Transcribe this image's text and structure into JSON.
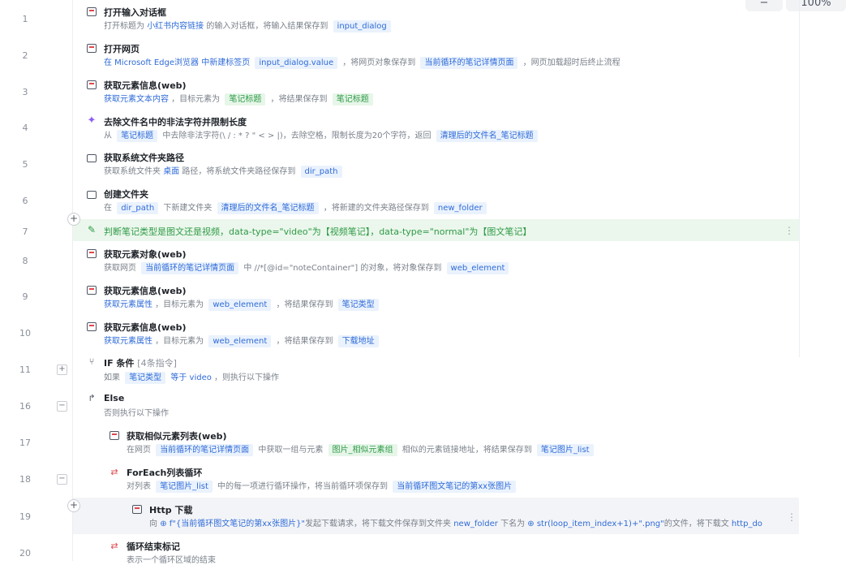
{
  "toolbar": {
    "zoom_out": "−",
    "zoom_level": "100%"
  },
  "steps": [
    {
      "line": "1",
      "title": "打开输入对话框",
      "desc": "打开标题为 {小红书内容链接} 的输入对话框，将输入结果保存到 [input_dialog]"
    },
    {
      "line": "2",
      "title": "打开网页",
      "desc": "在 Microsoft Edge浏览器 中新建标签页 [input_dialog.value] ，将网页对象保存到 [当前循环的笔记详情页面] ，网页加载超时后终止流程"
    },
    {
      "line": "3",
      "title": "获取元素信息(web)",
      "desc": "获取元素文本内容 ，目标元素为 [笔记标题] ，将结果保存到 [笔记标题]"
    },
    {
      "line": "4",
      "title": "去除文件名中的非法字符并限制长度",
      "desc": "从 [笔记标题] 中去除非法字符(\\ / : * ? \" < > |)，去除空格，限制长度为20个字符，返回 [清理后的文件名_笔记标题]"
    },
    {
      "line": "5",
      "title": "获取系统文件夹路径",
      "desc": "获取系统文件夹 桌面 路径，将系统文件夹路径保存到 [dir_path]"
    },
    {
      "line": "6",
      "title": "创建文件夹",
      "desc": "在 [dir_path] 下新建文件夹 [清理后的文件名_笔记标题] ，将新建的文件夹路径保存到 [new_folder]"
    },
    {
      "line": "7",
      "title": "判断笔记类型是图文还是视频，data-type=\"video\"为【视频笔记】，data-type=\"normal\"为【图文笔记】"
    },
    {
      "line": "8",
      "title": "获取元素对象(web)",
      "desc": "获取网页 [当前循环的笔记详情页面] 中 //*[@id=\"noteContainer\"] 的对象，将对象保存到 [web_element]"
    },
    {
      "line": "9",
      "title": "获取元素信息(web)",
      "desc": "获取元素属性 ，目标元素为 [web_element] ，将结果保存到 [笔记类型]"
    },
    {
      "line": "10",
      "title": "获取元素信息(web)",
      "desc": "获取元素属性 ，目标元素为 [web_element] ，将结果保存到 [下载地址]"
    },
    {
      "line": "11",
      "title": "IF 条件",
      "count": "[4条指令]",
      "desc": "如果 [笔记类型] 等于 video ，则执行以下操作"
    },
    {
      "line": "16",
      "title": "Else",
      "desc": "否则执行以下操作"
    },
    {
      "line": "17",
      "title": "获取相似元素列表(web)",
      "desc": "在网页 [当前循环的笔记详情页面] 中获取一组与元素 [图片_相似元素组] 相似的元素链接地址，将结果保存到 [笔记图片_list]"
    },
    {
      "line": "18",
      "title": "ForEach列表循环",
      "desc": "对列表 [笔记图片_list] 中的每一项进行循环操作，将当前循环项保存到 [当前循环图文笔记的第xx张图片]"
    },
    {
      "line": "19",
      "title": "Http 下载",
      "desc": "向 f\"{当前循环图文笔记的第xx张图片}\"发起下载请求，将下载文件保存到文件夹 new_folder 下名为 str(loop_item_index+1)+\".png\"的文件，将下载文 http_do"
    },
    {
      "line": "20",
      "title": "循环结束标记",
      "desc": "表示一个循环区域的结束"
    }
  ],
  "parts": {
    "s1a": "打开标题为 ",
    "s1b": "小红书内容链接",
    "s1c": " 的输入对话框，将输入结果保存到 ",
    "s1d": "input_dialog",
    "s2a": "在 Microsoft Edge浏览器 中新建标签页 ",
    "s2b": "input_dialog.value",
    "s2c": " ，将网页对象保存到 ",
    "s2d": "当前循环的笔记详情页面",
    "s2e": " ，网页加载超时后终止流程",
    "s3a": "获取元素文本内容",
    "s3b": " ，目标元素为 ",
    "s3c": "笔记标题",
    "s3d": " ，将结果保存到 ",
    "s3e": "笔记标题",
    "s4a": "从 ",
    "s4b": "笔记标题",
    "s4c": " 中去除非法字符(\\ / : * ? \" < > |)，去除空格，限制长度为20个字符，返回 ",
    "s4d": "清理后的文件名_笔记标题",
    "s5a": "获取系统文件夹 ",
    "s5b": "桌面",
    "s5c": " 路径，将系统文件夹路径保存到 ",
    "s5d": "dir_path",
    "s6a": "在 ",
    "s6b": "dir_path",
    "s6c": " 下新建文件夹 ",
    "s6d": "清理后的文件名_笔记标题",
    "s6e": " ，将新建的文件夹路径保存到 ",
    "s6f": "new_folder",
    "s8a": "获取网页 ",
    "s8b": "当前循环的笔记详情页面",
    "s8c": " 中 //*[@id=\"noteContainer\"] 的对象，将对象保存到 ",
    "s8d": "web_element",
    "s9a": "获取元素属性",
    "s9b": " ，目标元素为 ",
    "s9c": "web_element",
    "s9d": " ，将结果保存到 ",
    "s9e": "笔记类型",
    "s10a": "获取元素属性",
    "s10b": " ，目标元素为 ",
    "s10c": "web_element",
    "s10d": " ，将结果保存到 ",
    "s10e": "下载地址",
    "s11a": "如果 ",
    "s11b": "笔记类型",
    "s11c": " 等于 ",
    "s11d": "video",
    "s11e": " ，则执行以下操作",
    "s17a": "在网页 ",
    "s17b": "当前循环的笔记详情页面",
    "s17c": " 中获取一组与元素 ",
    "s17d": "图片_相似元素组",
    "s17e": " 相似的元素链接地址，将结果保存到 ",
    "s17f": "笔记图片_list",
    "s18a": "对列表 ",
    "s18b": "笔记图片_list",
    "s18c": " 中的每一项进行循环操作，将当前循环项保存到 ",
    "s18d": "当前循环图文笔记的第xx张图片",
    "s19a": "向 ",
    "s19b": "⊕ f\"{当前循环图文笔记的第xx张图片}\"",
    "s19c": "发起下载请求，将下载文件保存到文件夹 ",
    "s19d": "new_folder",
    "s19e": " 下名为 ",
    "s19f": "⊕ str(loop_item_index+1)+\".png\"",
    "s19g": "的文件，将下载文 ",
    "s19h": "http_do"
  }
}
